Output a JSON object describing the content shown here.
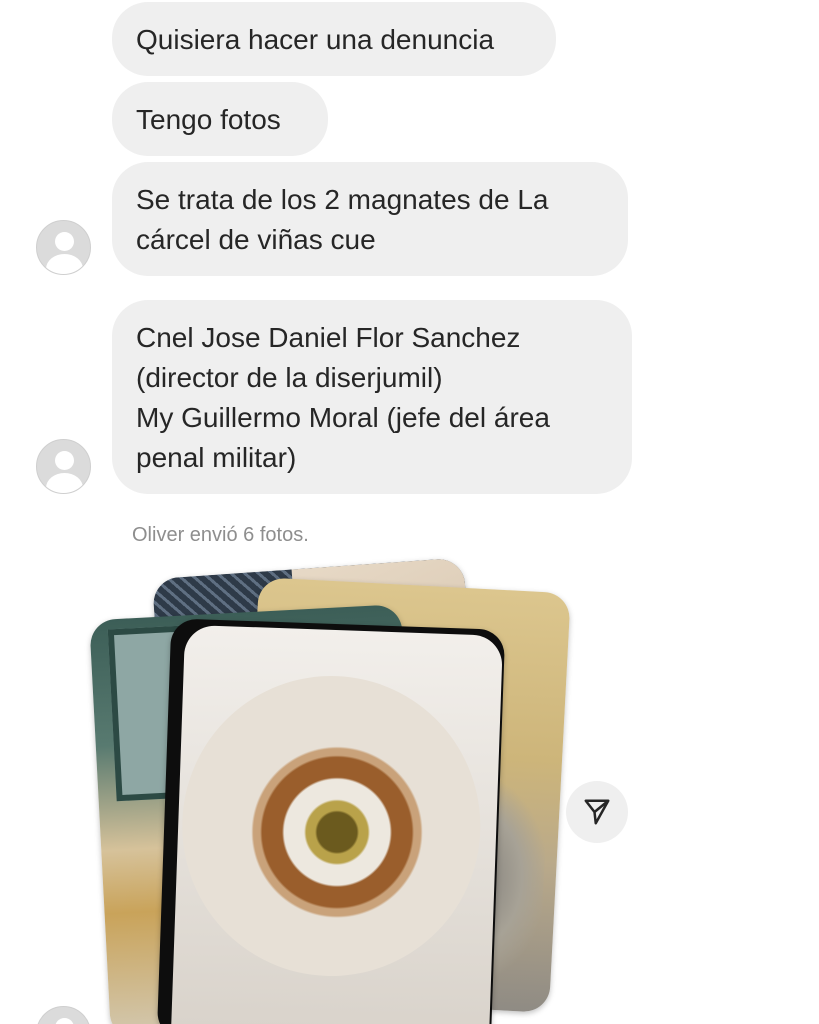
{
  "messages": [
    {
      "text": "Quisiera hacer una denuncia"
    },
    {
      "text": "Tengo fotos"
    },
    {
      "text": "Se trata de los 2 magnates de La\ncárcel de viñas cue"
    },
    {
      "text": "Cnel Jose Daniel Flor Sanchez\n(director de la diserjumil)\nMy Guillermo Moral (jefe del área\npenal militar)"
    }
  ],
  "photo_notice": "Oliver envió 6 fotos.",
  "icons": {
    "avatar": "default-avatar-icon",
    "share": "paper-plane-icon"
  },
  "colors": {
    "bubble": "#efefef",
    "text": "#262626",
    "muted": "#8e8e8e"
  }
}
